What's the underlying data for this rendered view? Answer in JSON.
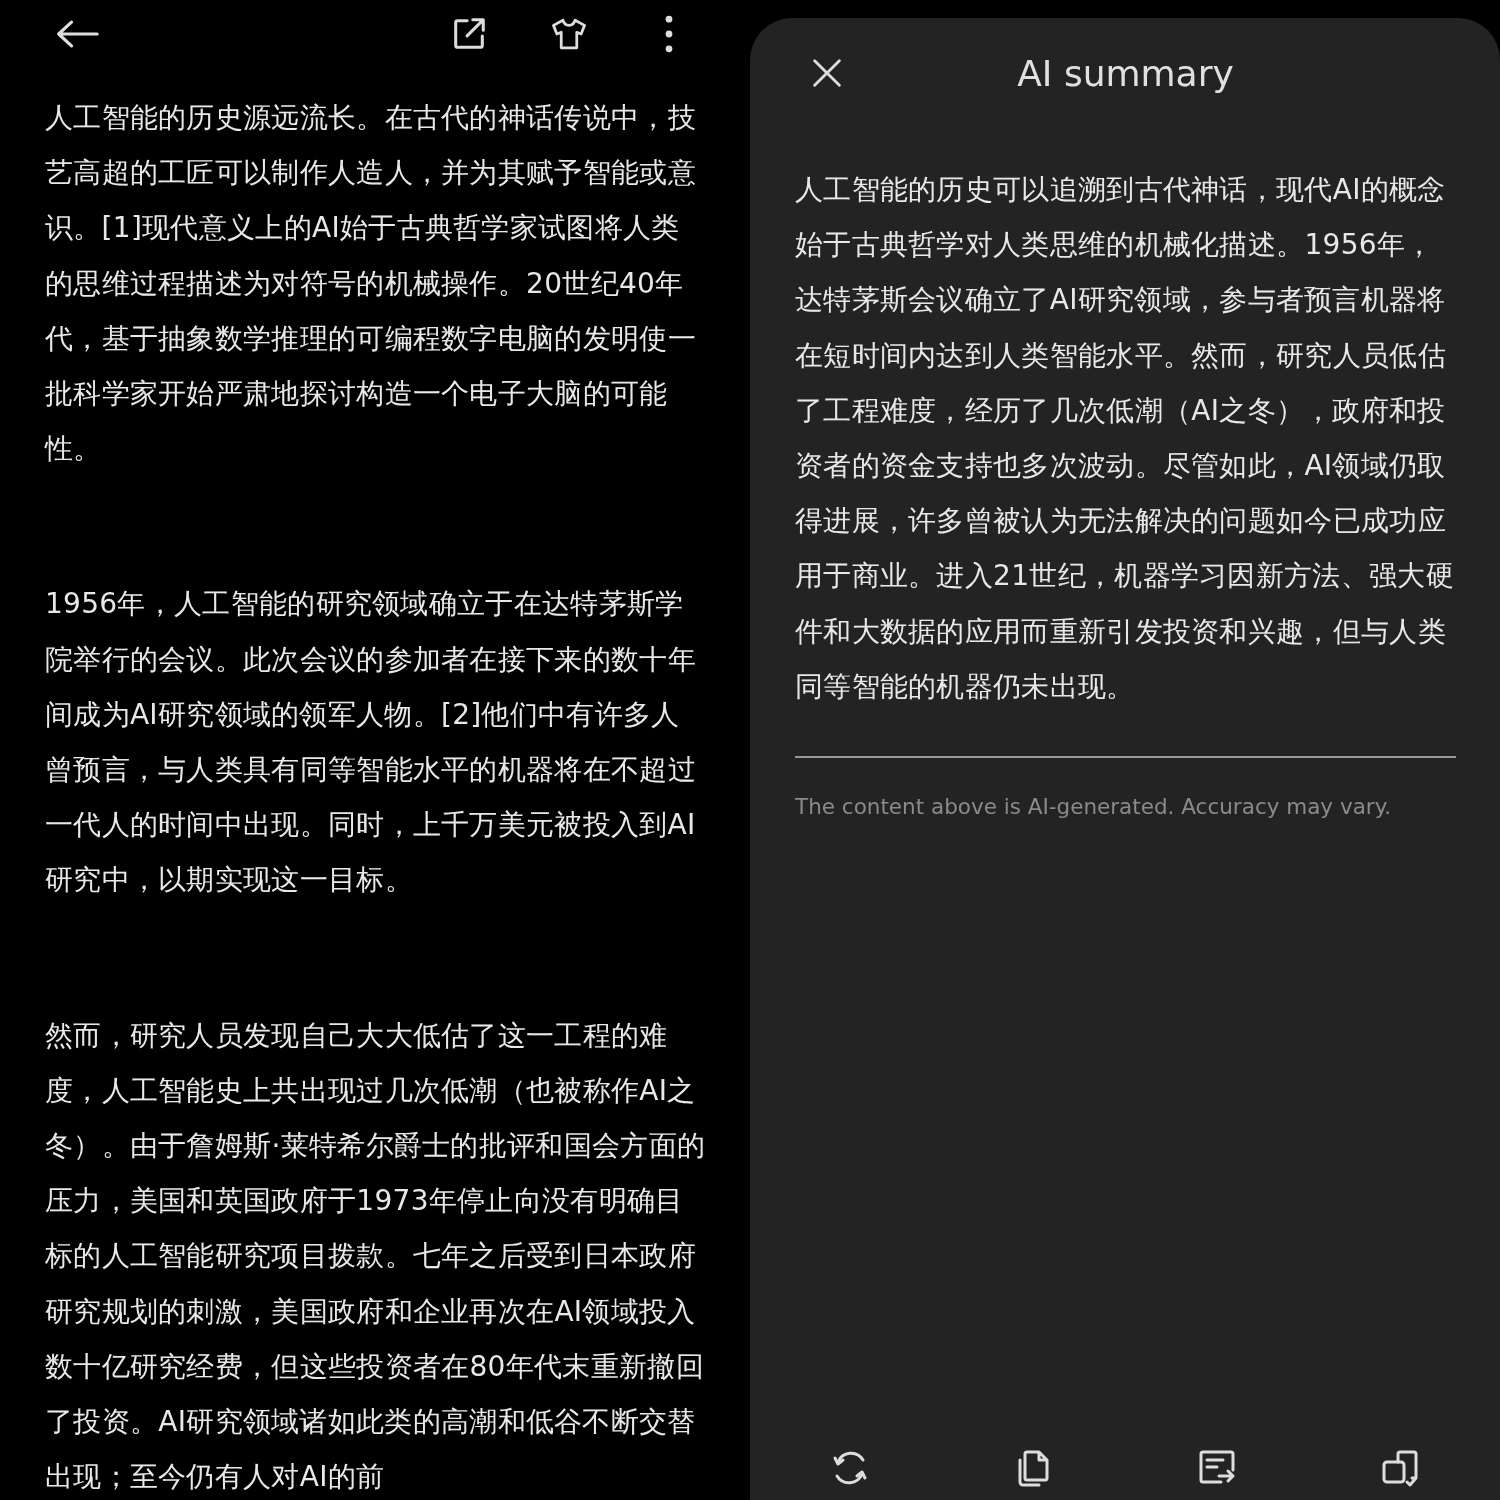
{
  "article": {
    "paragraphs": [
      "人工智能的历史源远流长。在古代的神话传说中，技艺高超的工匠可以制作人造人，并为其赋予智能或意识。[1]现代意义上的AI始于古典哲学家试图将人类的思维过程描述为对符号的机械操作。20世纪40年代，基于抽象数学推理的可编程数字电脑的发明使一批科学家开始严肃地探讨构造一个电子大脑的可能性。",
      "1956年，人工智能的研究领域确立于在达特茅斯学院举行的会议。此次会议的参加者在接下来的数十年间成为AI研究领域的领军人物。[2]他们中有许多人曾预言，与人类具有同等智能水平的机器将在不超过一代人的时间中出现。同时，上千万美元被投入到AI研究中，以期实现这一目标。",
      "然而，研究人员发现自己大大低估了这一工程的难度，人工智能史上共出现过几次低潮（也被称作AI之冬）。由于詹姆斯·莱特希尔爵士的批评和国会方面的压力，美国和英国政府于1973年停止向没有明确目标的人工智能研究项目拨款。七年之后受到日本政府研究规划的刺激，美国政府和企业再次在AI领域投入数十亿研究经费，但这些投资者在80年代末重新撤回了投资。AI研究领域诸如此类的高潮和低谷不断交替出现；至今仍有人对AI的前"
    ]
  },
  "summary_panel": {
    "title": "AI summary",
    "summary": "人工智能的历史可以追溯到古代神话，现代AI的概念始于古典哲学对人类思维的机械化描述。1956年，达特茅斯会议确立了AI研究领域，参与者预言机器将在短时间内达到人类智能水平。然而，研究人员低估了工程难度，经历了几次低潮（AI之冬），政府和投资者的资金支持也多次波动。尽管如此，AI领域仍取得进展，许多曾被认为无法解决的问题如今已成功应用于商业。进入21世纪，机器学习因新方法、强大硬件和大数据的应用而重新引发投资和兴趣，但与人类同等智能的机器仍未出现。",
    "disclaimer": "The content above is AI-generated. Accuracy may vary."
  }
}
